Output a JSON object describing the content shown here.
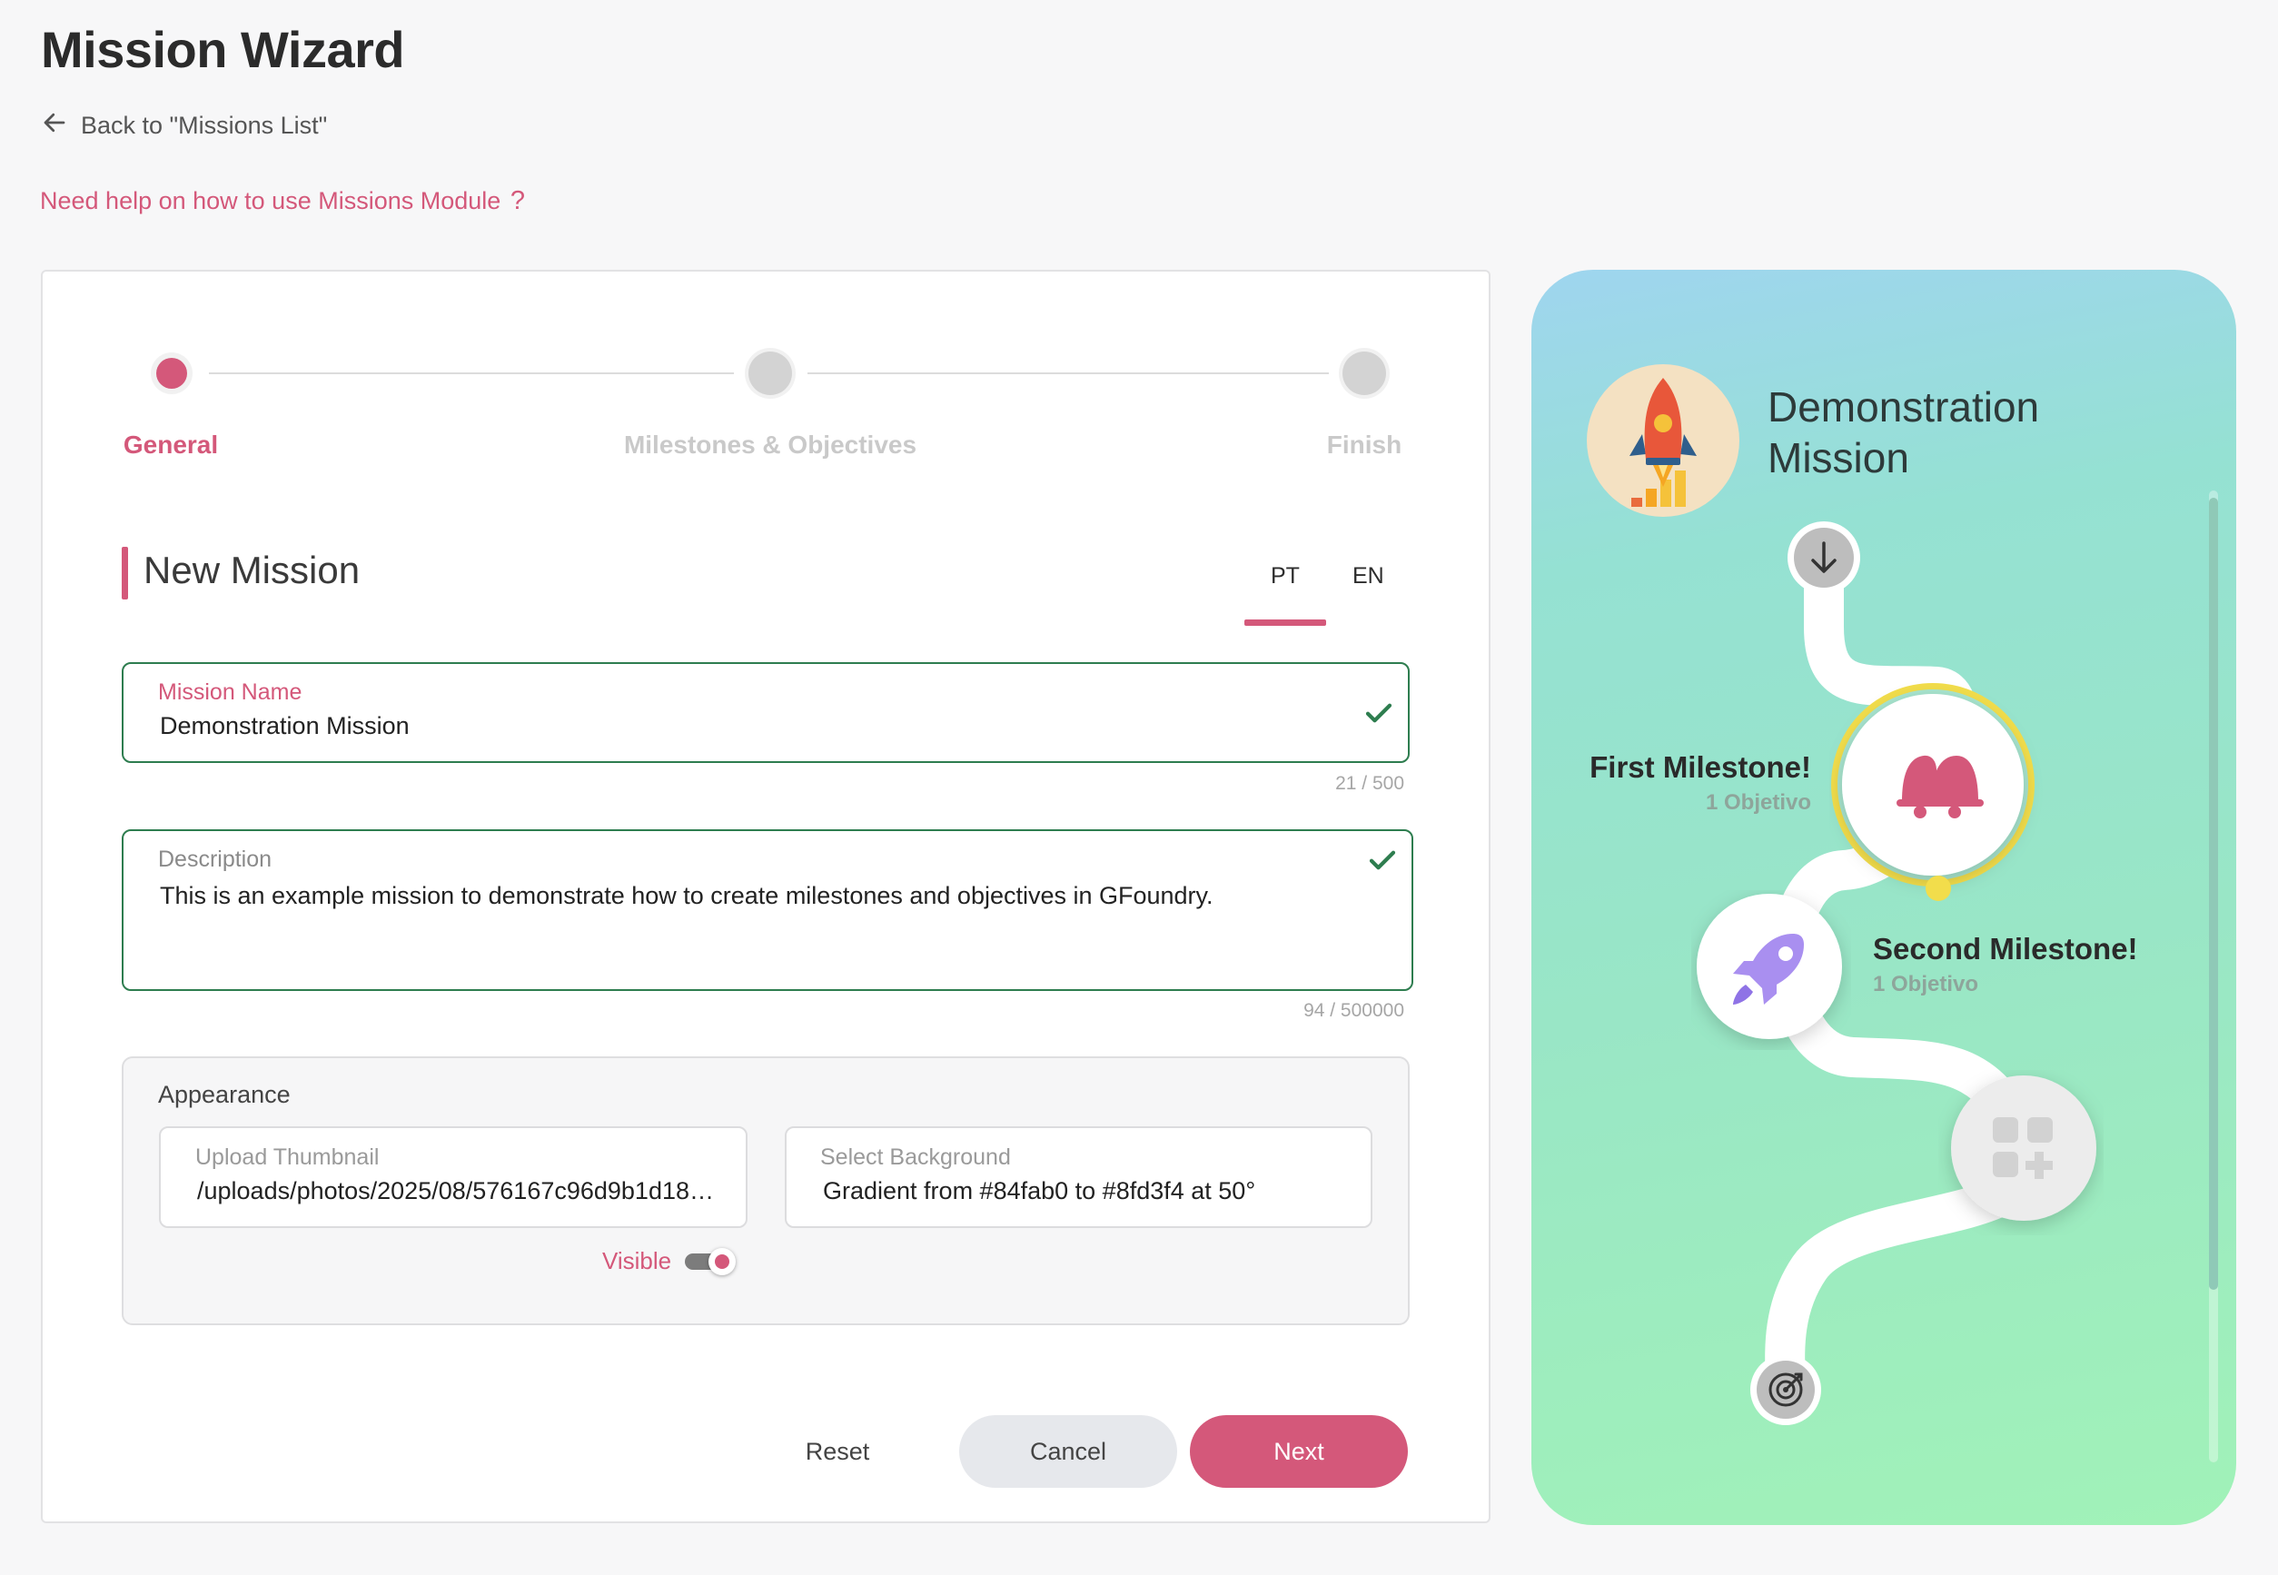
{
  "page": {
    "title": "Mission Wizard",
    "back_link": "Back to \"Missions List\"",
    "help_link": "Need help on how to use Missions Module"
  },
  "stepper": {
    "steps": [
      {
        "label": "General",
        "state": "active"
      },
      {
        "label": "Milestones & Objectives",
        "state": "inactive"
      },
      {
        "label": "Finish",
        "state": "inactive"
      }
    ]
  },
  "form": {
    "section_title": "New Mission",
    "languages": [
      "PT",
      "EN"
    ],
    "active_language": "PT",
    "mission_name": {
      "label": "Mission Name",
      "value": "Demonstration Mission",
      "counter": "21 / 500"
    },
    "description": {
      "label": "Description",
      "value": "This is an example mission to demonstrate how to create milestones and objectives in GFoundry.",
      "counter": "94 / 500000"
    },
    "appearance": {
      "title": "Appearance",
      "thumbnail": {
        "label": "Upload Thumbnail",
        "value": "/uploads/photos/2025/08/576167c96d9b1d186…"
      },
      "background": {
        "label": "Select Background",
        "value": "Gradient from #84fab0 to #8fd3f4 at 50°"
      },
      "visible_label": "Visible",
      "visible": true
    },
    "buttons": {
      "reset": "Reset",
      "cancel": "Cancel",
      "next": "Next"
    }
  },
  "preview": {
    "title_line1": "Demonstration",
    "title_line2": "Mission",
    "milestones": [
      {
        "title": "First Milestone!",
        "subtitle": "1 Objetivo",
        "icon": "bell-icon"
      },
      {
        "title": "Second Milestone!",
        "subtitle": "1 Objetivo",
        "icon": "rocket-icon"
      }
    ],
    "add_milestone_icon": "add-grid-icon",
    "start_icon": "arrow-down-icon",
    "end_icon": "target-icon"
  },
  "colors": {
    "accent": "#d4587a",
    "valid_border": "#2e7d4f",
    "gradient_start": "#84fab0",
    "gradient_end": "#8fd3f4",
    "progress": "#f2dd4b"
  }
}
